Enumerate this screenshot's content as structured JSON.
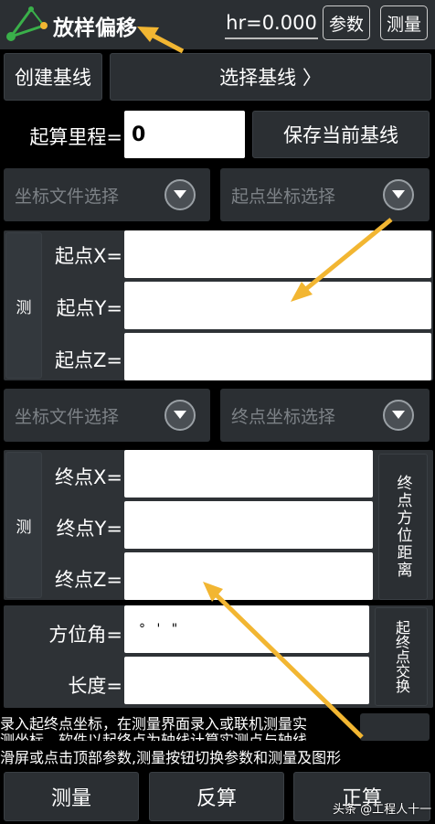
{
  "header": {
    "title": "放样偏移",
    "hr_value": "hr=0.000",
    "params_label": "参数",
    "measure_label": "测量"
  },
  "baseline": {
    "create_label": "创建基线",
    "select_label": "选择基线 〉",
    "start_mileage_label": "起算里程=",
    "start_mileage_value": "0",
    "save_label": "保存当前基线"
  },
  "start_point": {
    "file_select": "坐标文件选择",
    "coord_select": "起点坐标选择",
    "measure_label": "测",
    "x_label": "起点X=",
    "y_label": "起点Y=",
    "z_label": "起点Z=",
    "x_value": "",
    "y_value": "",
    "z_value": ""
  },
  "end_point": {
    "file_select": "坐标文件选择",
    "coord_select": "终点坐标选择",
    "measure_label": "测",
    "x_label": "终点X=",
    "y_label": "终点Y=",
    "z_label": "终点Z=",
    "bearing_distance_label": "终点方位距离",
    "x_value": "",
    "y_value": "",
    "z_value": ""
  },
  "bearing": {
    "azimuth_label": "方位角=",
    "azimuth_value": "° ' \"",
    "length_label": "长度=",
    "length_value": "",
    "swap_label": "起终点交换"
  },
  "hints": {
    "line1": "录入起终点坐标，在测量界面录入或联机测量实",
    "line2": "测坐标，软件以起终点为轴线计算实测点与轴线",
    "line3": "滑屏或点击顶部参数,测量按钮切换参数和测量及图形"
  },
  "bottom": {
    "measure": "测量",
    "inverse": "反算",
    "forward": "正算"
  },
  "watermark": "头条 @工程人十一",
  "colors": {
    "topbar": "#2b2f33",
    "accent": "#f2b632",
    "panel": "#2e3236"
  }
}
